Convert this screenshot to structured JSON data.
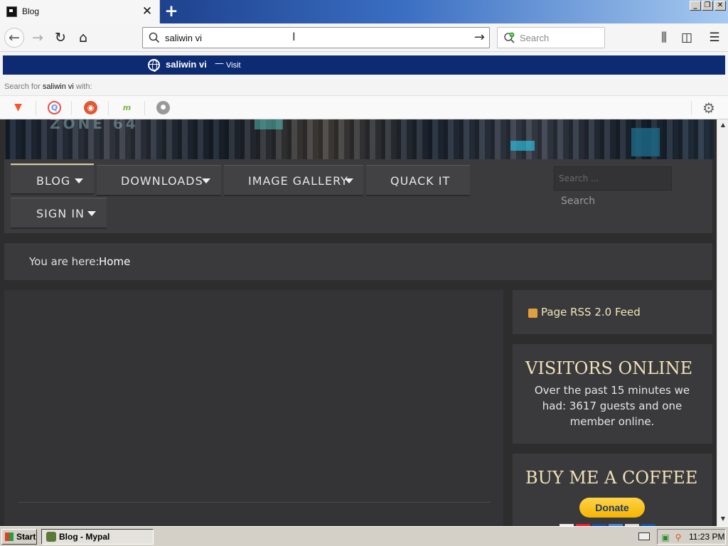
{
  "browser": {
    "tab_title": "Blog",
    "tab_close": "✕",
    "new_tab": "+",
    "url_text": "saliwin vi",
    "search_placeholder": "Search",
    "window_buttons": [
      "_",
      "❐",
      "✕"
    ]
  },
  "suggestions": {
    "primary": "saliwin vi",
    "separator": "—",
    "action": "Visit",
    "search_for_prefix": "Search for",
    "search_for_query": "saliwin vi",
    "search_for_suffix": "with:",
    "engines": [
      {
        "name": "brave",
        "color": "#fb542b",
        "glyph": "▼"
      },
      {
        "name": "qwant",
        "color": "#5c97ff",
        "glyph": "Q"
      },
      {
        "name": "duckduckgo",
        "color": "#de5833",
        "glyph": "◉"
      },
      {
        "name": "mojeek",
        "color": "#7ab93d",
        "glyph": "m"
      },
      {
        "name": "search",
        "color": "#888888",
        "glyph": "●"
      }
    ]
  },
  "site": {
    "menu": [
      {
        "label": "BLOG",
        "has_caret": true,
        "active": true
      },
      {
        "label": "DOWNLOADS",
        "has_caret": true,
        "active": false
      },
      {
        "label": "IMAGE GALLERY",
        "has_caret": true,
        "active": false
      },
      {
        "label": "QUACK IT",
        "has_caret": false,
        "active": false
      },
      {
        "label": "SIGN IN",
        "has_caret": true,
        "active": false
      }
    ],
    "search_placeholder": "Search ...",
    "search_button": "Search",
    "breadcrumb_label": "You are here:",
    "breadcrumb_home": "Home",
    "rss_link": "Page RSS 2.0 Feed",
    "visitors_title": "VISITORS ONLINE",
    "visitors_text": "Over the past 15 minutes we had: 3617 guests and one member online.",
    "coffee_title": "BUY ME A COFFEE",
    "donate_label": "Donate"
  },
  "taskbar": {
    "start_label": "Start",
    "task_label": "Blog - Mypal",
    "clock": "11:23 PM"
  },
  "colors": {
    "accent_gold": "#efe0b8",
    "suggest_bg": "#0d2b73",
    "page_bg": "#2d2d2e"
  }
}
